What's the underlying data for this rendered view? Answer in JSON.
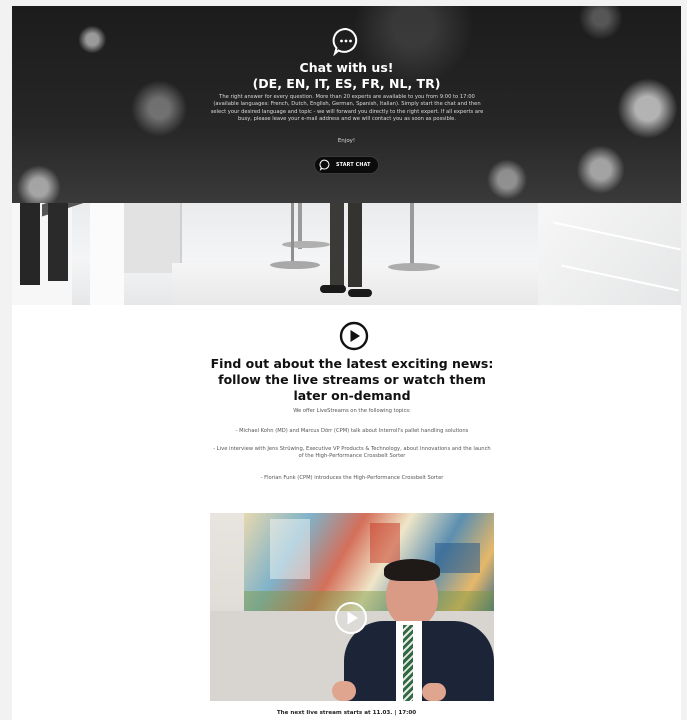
{
  "hero": {
    "title_line1": "Chat with us!",
    "title_line2": "(DE, EN, IT, ES, FR, NL, TR)",
    "description": "The right answer for every question. More than 20 experts are available to you from 9:00 to 17:00 (available languages: French, Dutch, English, German, Spanish, Italian). Simply start the chat and then select your desired language and topic - we will forward you directly to the right expert. If all experts are busy, please leave your e-mail address and we will contact you as soon as possible.",
    "enjoy": "Enjoy!",
    "start_chat_label": "START CHAT",
    "chat_icon": "chat-bubble-icon"
  },
  "news": {
    "heading": "Find out about the latest exciting news: follow the live streams or watch them later on-demand",
    "intro": "We offer LiveStreams on the following topics:",
    "topics": [
      "- Michael Kohn (MD) and Marcus Dörr (CPM) talk about Interroll's pallet handling solutions",
      "- Live interview with Jens Strüwing, Executive VP Products & Technology, about Innovations and the launch of the High-Performance Crossbelt Sorter",
      "- Florian Funk (CPM) introduces the High-Performance Crossbelt Sorter"
    ],
    "play_icon": "play-circle-icon"
  },
  "video": {
    "caption": "The next live stream starts at 11.03. | 17:00"
  }
}
